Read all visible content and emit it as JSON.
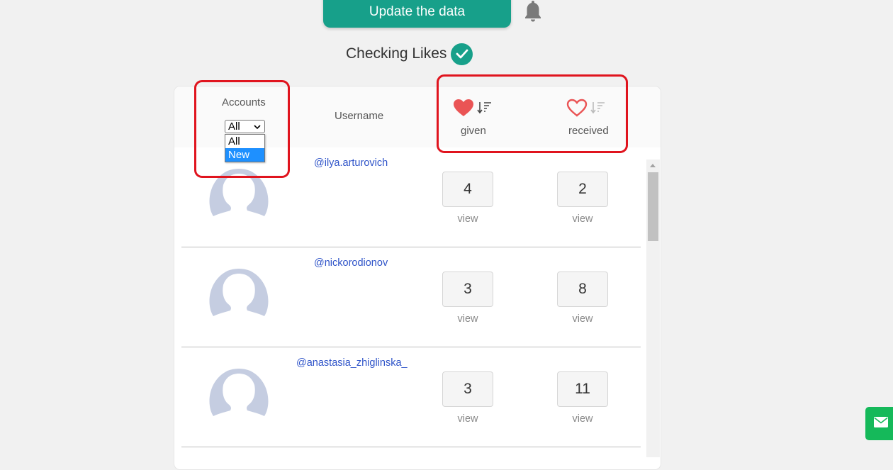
{
  "header": {
    "update_button": "Update the data",
    "bell_icon": "bell-icon",
    "title": "Checking Likes",
    "title_icon": "check-circle-icon"
  },
  "table": {
    "accounts_label": "Accounts",
    "accounts_select": {
      "selected": "All",
      "options": [
        "All",
        "New"
      ],
      "highlighted": "New"
    },
    "username_label": "Username",
    "given": {
      "icon": "heart-filled-icon",
      "sort_icon": "sort-desc-icon",
      "label": "given"
    },
    "received": {
      "icon": "heart-outline-icon",
      "sort_icon": "sort-desc-icon",
      "label": "received"
    },
    "rows": [
      {
        "username": "@ilya.arturovich",
        "given": "4",
        "received": "2",
        "given_link": "view",
        "received_link": "view"
      },
      {
        "username": "@nickorodionov",
        "given": "3",
        "received": "8",
        "given_link": "view",
        "received_link": "view"
      },
      {
        "username": "@anastasia_zhiglinska_",
        "given": "3",
        "received": "11",
        "given_link": "view",
        "received_link": "view"
      }
    ]
  },
  "colors": {
    "accent": "#17a08a",
    "heart": "#ea5455",
    "link": "#2f54c9",
    "highlight_box": "#e0141e",
    "mail_button": "#15b95a"
  },
  "floating": {
    "mail_icon": "envelope-icon"
  }
}
